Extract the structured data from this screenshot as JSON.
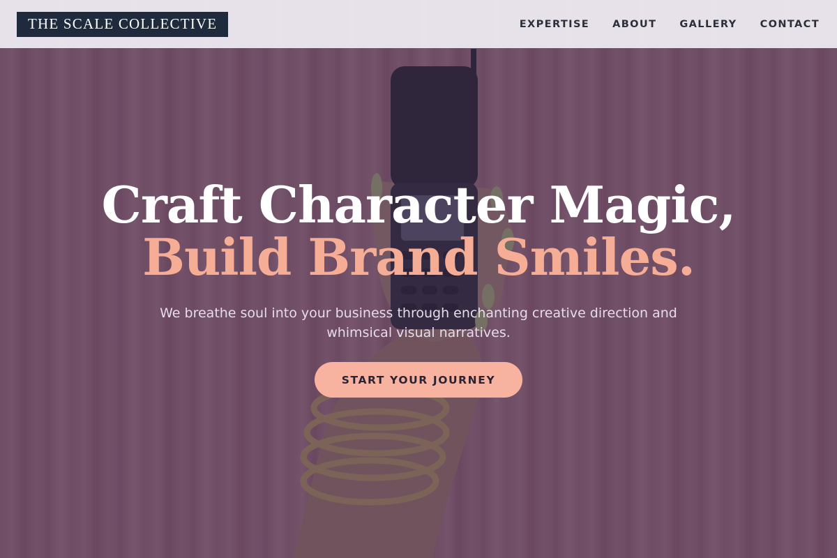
{
  "header": {
    "logo_text": "THE SCALE COLLECTIVE",
    "nav": [
      {
        "label": "EXPERTISE"
      },
      {
        "label": "ABOUT"
      },
      {
        "label": "GALLERY"
      },
      {
        "label": "CONTACT"
      }
    ]
  },
  "hero": {
    "headline_line1": "Craft Character Magic,",
    "headline_line2": "Build Brand Smiles.",
    "subtitle": "We breathe soul into your business through enchanting creative direction and whimsical visual narratives.",
    "cta_label": "START YOUR JOURNEY"
  },
  "colors": {
    "header_bg": "#ece8ee",
    "logo_bg": "#1f2a3d",
    "accent": "#f7b39f",
    "overlay": "#3a2844"
  }
}
